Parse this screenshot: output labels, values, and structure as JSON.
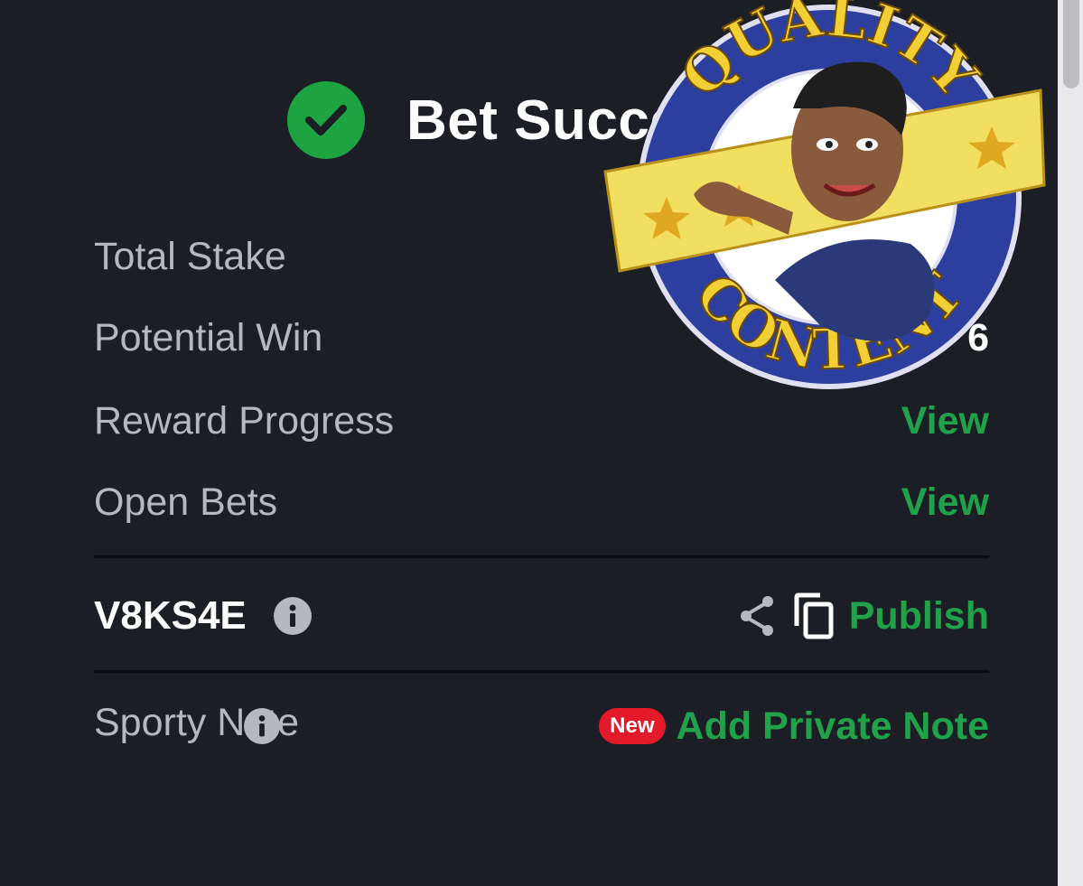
{
  "header": {
    "title": "Bet Successful"
  },
  "rows": [
    {
      "label": "Total Stake",
      "value": ""
    },
    {
      "label": "Potential Win",
      "value": "6"
    },
    {
      "label": "Reward Progress",
      "link": "View"
    },
    {
      "label": "Open Bets",
      "link": "View"
    }
  ],
  "booking": {
    "code": "V8KS4E",
    "publish_label": "Publish"
  },
  "note": {
    "label": "Sporty Note",
    "badge": "New",
    "action_label": "Add Private Note"
  },
  "sticker": {
    "top_text": "QUALITY",
    "bottom_text": "CONTENT"
  },
  "colors": {
    "background": "#1b1e25",
    "accent_green": "#21a14a",
    "check_green": "#1ea341",
    "new_badge_red": "#e21a2a",
    "label_gray": "#b5b8c0"
  },
  "icons": [
    "check-icon",
    "info-icon",
    "share-icon",
    "copy-icon"
  ]
}
